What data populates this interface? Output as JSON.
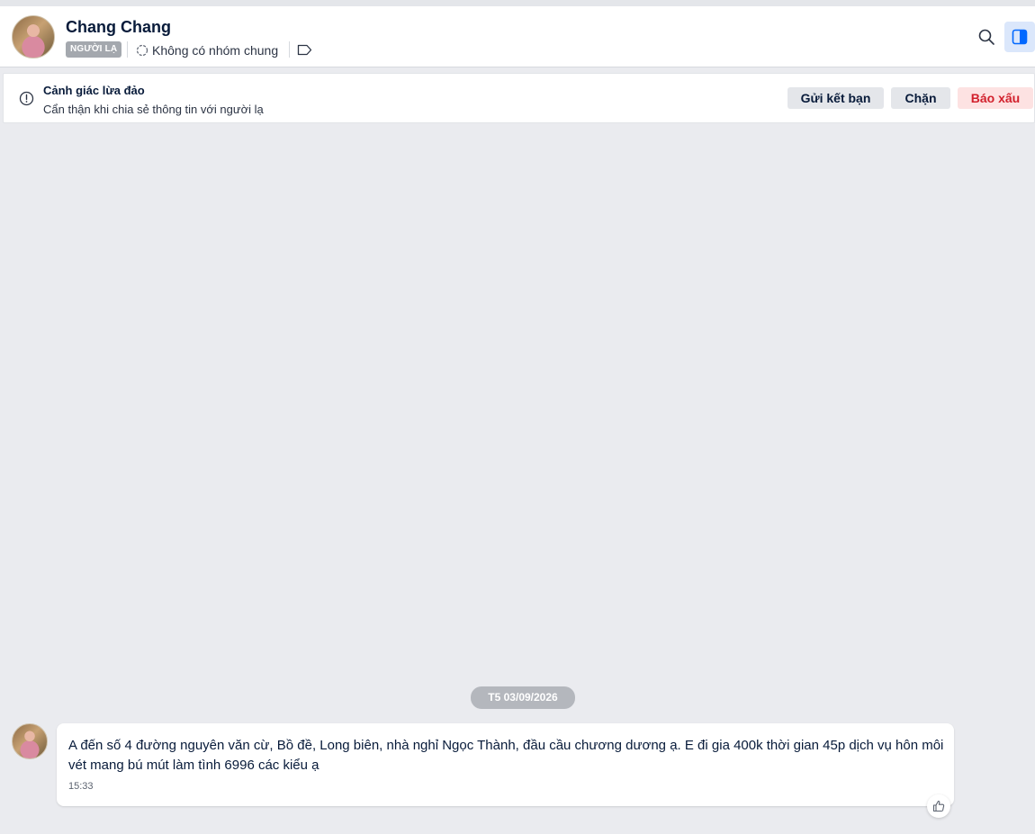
{
  "header": {
    "contact_name": "Chang Chang",
    "badge": "NGƯỜI LẠ",
    "groups_text": "Không có nhóm chung"
  },
  "warning": {
    "title": "Cảnh giác lừa đảo",
    "text": "Cẩn thận khi chia sẻ thông tin với người lạ",
    "add_friend_label": "Gửi kết bạn",
    "block_label": "Chặn",
    "report_label": "Báo xấu"
  },
  "conversation": {
    "date_divider": "T5 03/09/2026",
    "messages": [
      {
        "text": "A đến số 4 đường nguyên văn cừ, Bồ đề, Long biên, nhà nghỉ Ngọc Thành, đầu cầu chương dương ạ. E đi gia 400k thời gian 45p dịch vụ hôn môi vét mang bú mút làm tình 6996 các kiểu ạ",
        "time": "15:33"
      }
    ]
  },
  "colors": {
    "accent": "#0068ff",
    "report_red": "#d2202c",
    "background": "#eaebef"
  },
  "icons": [
    "search-icon",
    "side-panel-icon",
    "group-circle-icon",
    "tag-icon",
    "alert-circle-icon",
    "thumbs-up-icon"
  ]
}
